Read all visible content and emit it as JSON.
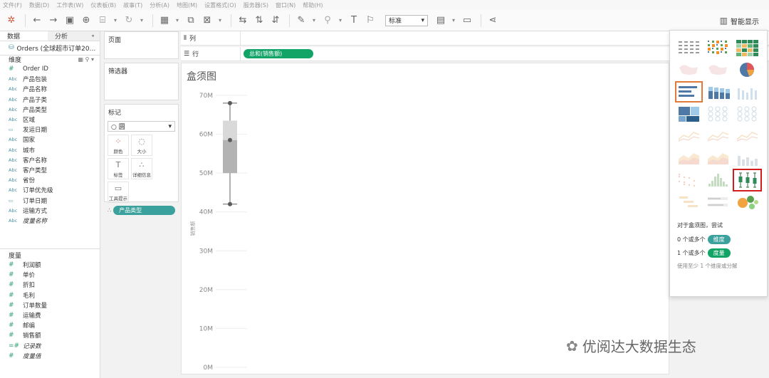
{
  "menu": [
    "文件(F)",
    "数据(D)",
    "工作表(W)",
    "仪表板(B)",
    "故事(T)",
    "分析(A)",
    "地图(M)",
    "设置格式(O)",
    "服务器(S)",
    "窗口(N)",
    "帮助(H)"
  ],
  "toolbar": {
    "fit_value": "标准",
    "show_me_label": "智能显示"
  },
  "data_pane": {
    "tab_data": "数据",
    "tab_analysis": "分析",
    "datasource": "Orders (全球超市订单20...",
    "dimensions_label": "维度",
    "dimensions": [
      {
        "type": "#",
        "name": "Order ID"
      },
      {
        "type": "Abc",
        "name": "产品包装"
      },
      {
        "type": "Abc",
        "name": "产品名称"
      },
      {
        "type": "Abc",
        "name": "产品子类"
      },
      {
        "type": "Abc",
        "name": "产品类型"
      },
      {
        "type": "Abc",
        "name": "区域"
      },
      {
        "type": "date",
        "name": "发运日期"
      },
      {
        "type": "Abc",
        "name": "国家"
      },
      {
        "type": "Abc",
        "name": "城市"
      },
      {
        "type": "Abc",
        "name": "客户名称"
      },
      {
        "type": "Abc",
        "name": "客户类型"
      },
      {
        "type": "Abc",
        "name": "省份"
      },
      {
        "type": "Abc",
        "name": "订单优先级"
      },
      {
        "type": "date",
        "name": "订单日期"
      },
      {
        "type": "Abc",
        "name": "运输方式"
      },
      {
        "type": "Abc",
        "name": "度量名称",
        "italic": true
      }
    ],
    "measures_label": "度量",
    "measures": [
      {
        "type": "#",
        "name": "利润额"
      },
      {
        "type": "#",
        "name": "单价"
      },
      {
        "type": "#",
        "name": "折扣"
      },
      {
        "type": "#",
        "name": "毛利"
      },
      {
        "type": "#",
        "name": "订单数量"
      },
      {
        "type": "#",
        "name": "运输费"
      },
      {
        "type": "#",
        "name": "邮编"
      },
      {
        "type": "#",
        "name": "销售额"
      },
      {
        "type": "=#",
        "name": "记录数",
        "italic": true
      },
      {
        "type": "#",
        "name": "度量值",
        "italic": true
      }
    ]
  },
  "cards": {
    "pages": "页面",
    "filters": "筛选器",
    "marks": "标记",
    "mark_type": "圆",
    "mark_buttons": [
      "颜色",
      "大小",
      "标签",
      "详细信息",
      "工具提示"
    ],
    "detail_pill": "产品类型"
  },
  "shelves": {
    "columns_label": "列",
    "rows_label": "行",
    "rows_pill": "总和(销售额)"
  },
  "chart_data": {
    "type": "box",
    "title": "盒须图",
    "ylabel": "销售额",
    "yticks": [
      "0M",
      "10M",
      "20M",
      "30M",
      "40M",
      "50M",
      "60M",
      "70M"
    ],
    "ylim": [
      0,
      70
    ],
    "box": {
      "min": 42,
      "q1": 50,
      "median": 58.5,
      "q3": 63.5,
      "max": 68
    },
    "points": [
      68,
      58.5,
      42
    ]
  },
  "show_me": {
    "hint_title": "对于盒须图，尝试",
    "row1_prefix": "0 个或多个",
    "row1_pill": "维度",
    "row2_prefix": "1 个或多个",
    "row2_pill": "度量",
    "foot": "使用至少 1 个维度或分解"
  },
  "watermark": "优阅达大数据生态",
  "colors": {
    "pill_dim": "#3aa19c",
    "pill_measure": "#12a367",
    "highlight": "#d21c1c",
    "selected": "#e07a3a"
  }
}
